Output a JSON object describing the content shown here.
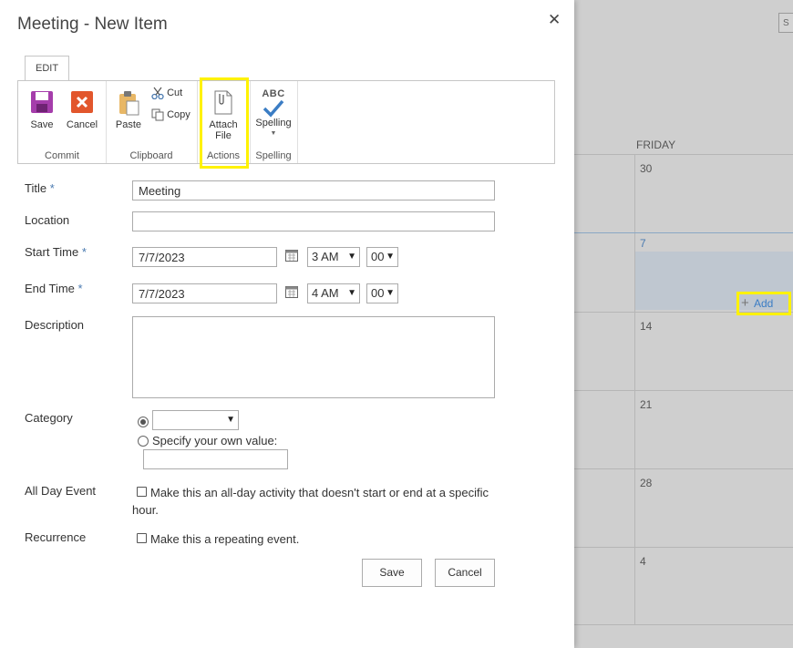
{
  "dialog": {
    "title": "Meeting - New Item",
    "close_icon": "close-icon"
  },
  "ribbon": {
    "tab": "EDIT",
    "groups": {
      "commit": {
        "label": "Commit",
        "save": "Save",
        "cancel": "Cancel"
      },
      "clipboard": {
        "label": "Clipboard",
        "paste": "Paste",
        "cut": "Cut",
        "copy": "Copy"
      },
      "actions": {
        "label": "Actions",
        "attach_line1": "Attach",
        "attach_line2": "File"
      },
      "spelling": {
        "label": "Spelling",
        "button": "Spelling",
        "abc": "ABC"
      }
    },
    "colors": {
      "save_icon": "#a53dab",
      "cancel_icon": "#e2562c",
      "highlight": "#fff200",
      "required": "#4a7ab0"
    }
  },
  "form": {
    "title": {
      "label": "Title",
      "required": "*",
      "value": "Meeting"
    },
    "location": {
      "label": "Location",
      "value": ""
    },
    "start_time": {
      "label": "Start Time",
      "required": "*",
      "date": "7/7/2023",
      "hour": "3 AM",
      "minute": "00"
    },
    "end_time": {
      "label": "End Time",
      "required": "*",
      "date": "7/7/2023",
      "hour": "4 AM",
      "minute": "00"
    },
    "description": {
      "label": "Description",
      "value": ""
    },
    "category": {
      "label": "Category",
      "selected": "",
      "own_value_label": "Specify your own value:"
    },
    "all_day": {
      "label": "All Day Event",
      "text_line1": "Make this an all-day activity that doesn't start or end at a specific",
      "text_line2": "hour."
    },
    "recurrence": {
      "label": "Recurrence",
      "text": "Make this a repeating event."
    },
    "save_label": "Save",
    "cancel_label": "Cancel"
  },
  "calendar": {
    "day_header": "FRIDAY",
    "dates": [
      "30",
      "7",
      "14",
      "21",
      "28",
      "4"
    ],
    "add_label": "Add",
    "top_button_label": "S"
  }
}
